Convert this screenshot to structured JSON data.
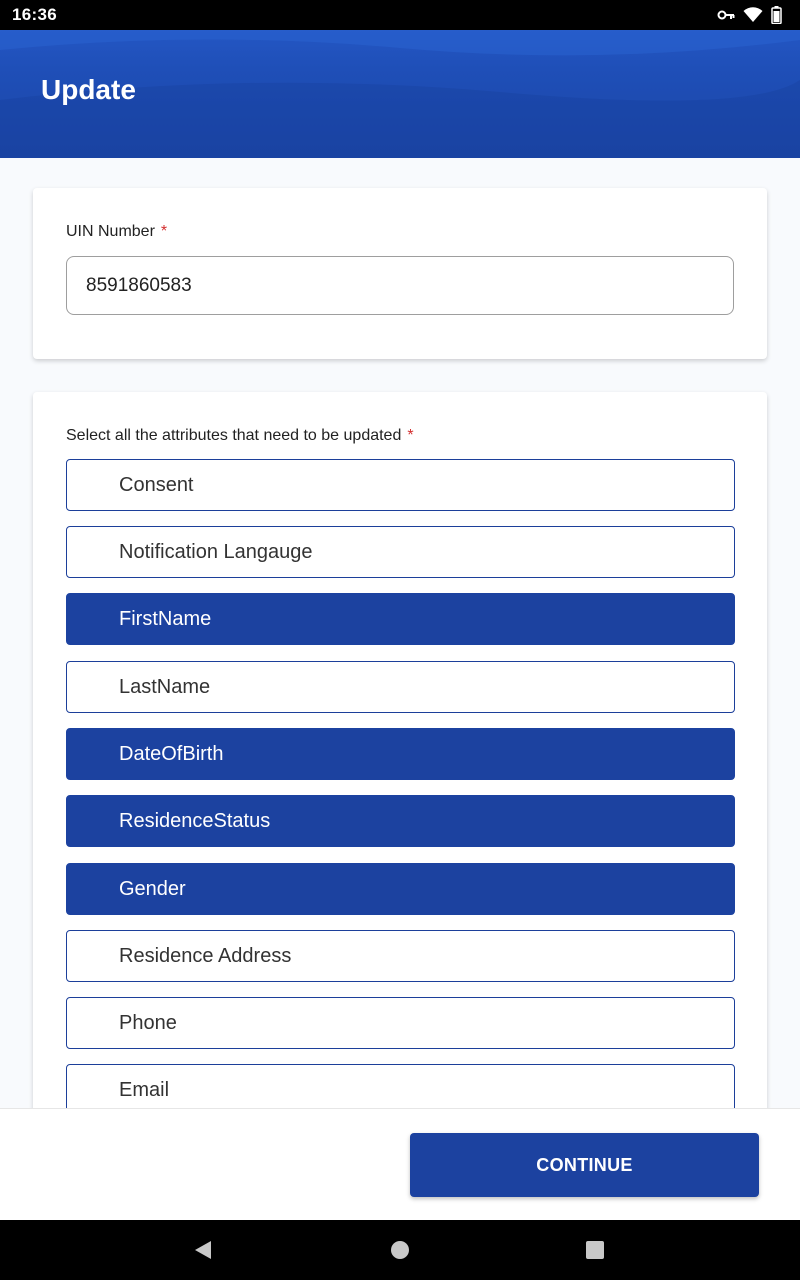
{
  "status_bar": {
    "time": "16:36",
    "icons": [
      "vpn-key-icon",
      "wifi-icon",
      "battery-icon"
    ]
  },
  "header": {
    "title": "Update"
  },
  "uin": {
    "label": "UIN Number",
    "required_mark": "*",
    "value": "8591860583"
  },
  "attributes": {
    "label": "Select all the attributes that need to be updated",
    "required_mark": "*",
    "options": [
      {
        "label": "Consent",
        "selected": false
      },
      {
        "label": "Notification Langauge",
        "selected": false
      },
      {
        "label": "FirstName",
        "selected": true
      },
      {
        "label": "LastName",
        "selected": false
      },
      {
        "label": "DateOfBirth",
        "selected": true
      },
      {
        "label": "ResidenceStatus",
        "selected": true
      },
      {
        "label": "Gender",
        "selected": true
      },
      {
        "label": "Residence Address",
        "selected": false
      },
      {
        "label": "Phone",
        "selected": false
      },
      {
        "label": "Email",
        "selected": false
      }
    ]
  },
  "footer": {
    "continue_label": "CONTINUE"
  },
  "nav_bar": {
    "icons": [
      "back-icon",
      "home-icon",
      "recents-icon"
    ]
  },
  "colors": {
    "primary": "#1c42a0",
    "header": "#1f4fb8",
    "required": "#d32f2f",
    "background": "#f8fafd"
  }
}
